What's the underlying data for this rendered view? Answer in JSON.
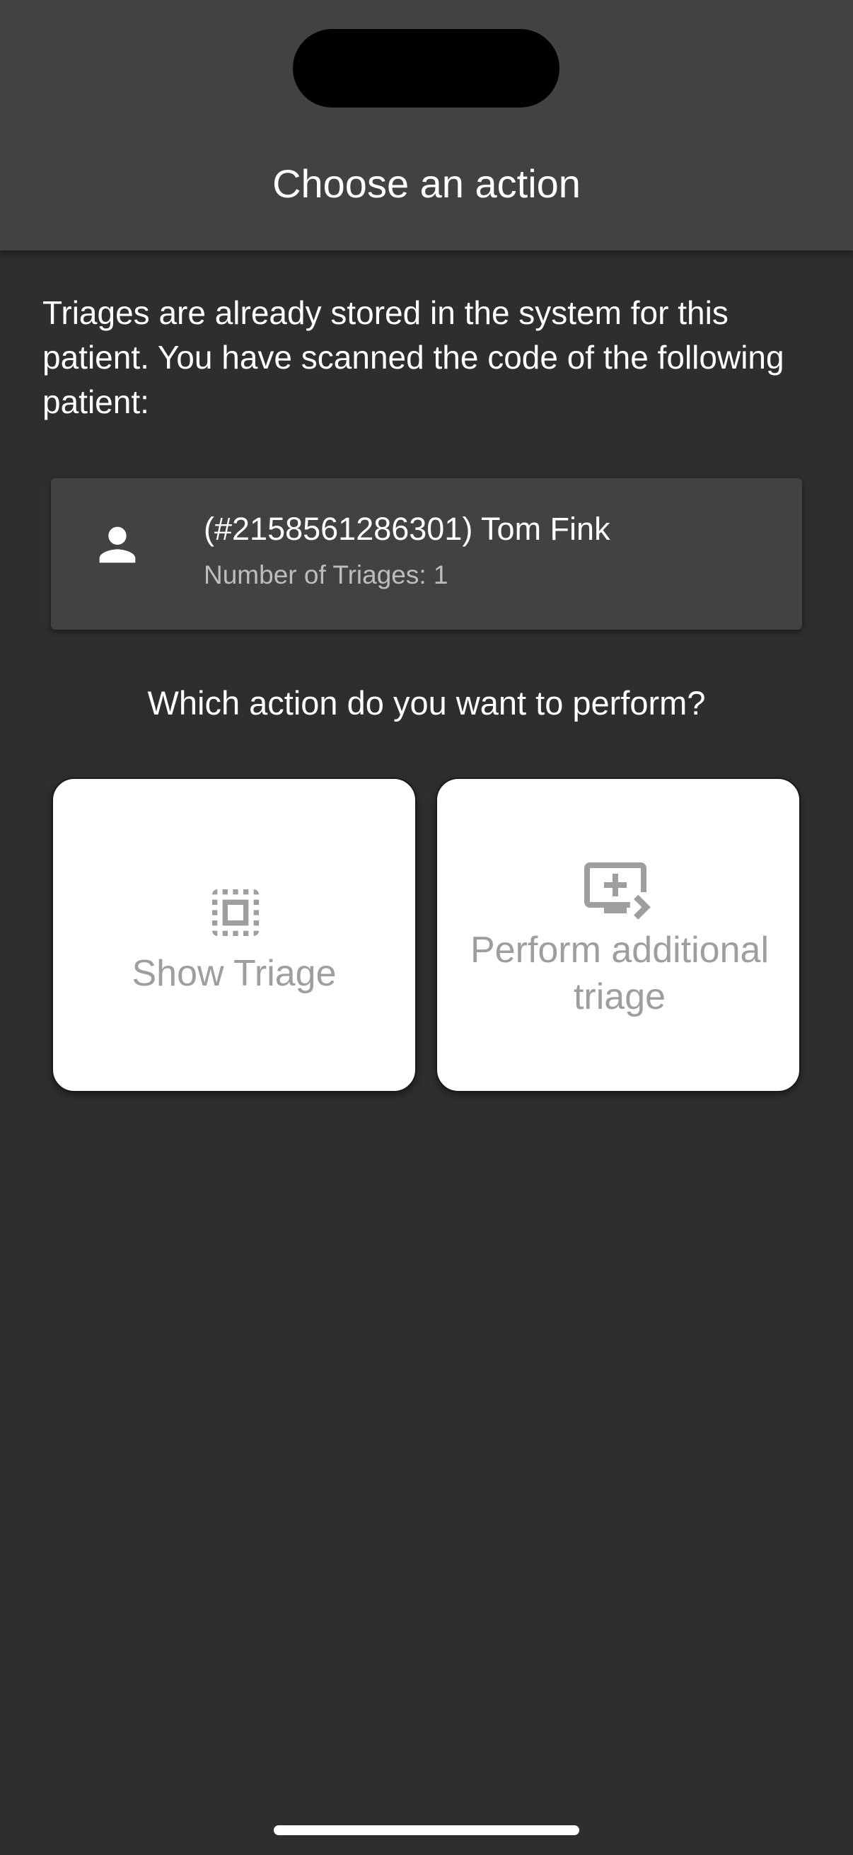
{
  "app_bar": {
    "title": "Choose an action"
  },
  "intro": {
    "text": "Triages are already stored in the system for this patient. You have scanned the code of the following patient:"
  },
  "patient": {
    "icon": "person-icon",
    "name": "(#2158561286301) Tom Fink",
    "triage_count": "Number of Triages: 1"
  },
  "question": {
    "text": "Which action do you want to perform?"
  },
  "actions": [
    {
      "label": "Show Triage",
      "icon": "select-all-icon"
    },
    {
      "label": "Perform additional triage",
      "icon": "add-to-queue-icon"
    }
  ],
  "colors": {
    "background": "#2e2e2e",
    "app_bar": "#424242",
    "card": "#424242",
    "action_card": "#ffffff",
    "action_text": "#9e9e9e",
    "secondary_text": "#bdbdbd"
  }
}
